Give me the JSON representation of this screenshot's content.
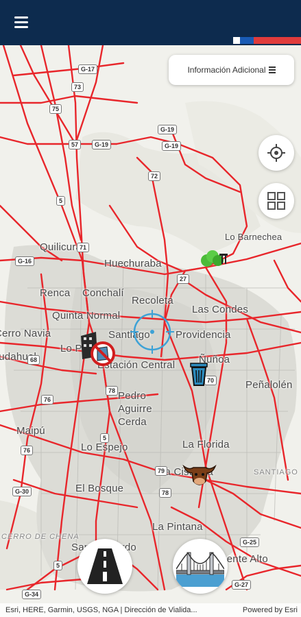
{
  "header": {
    "menu_icon": "hamburger-menu-icon",
    "background": "#0d2b4e",
    "flag_colors": [
      "#ffffff",
      "#1a5bb5",
      "#e03b3b"
    ]
  },
  "controls": {
    "info_button_label": "Información Adicional",
    "info_button_icon": "list-icon",
    "locate_icon": "crosshair-icon",
    "layers_icon": "grid-icon",
    "road_button_icon": "road-icon",
    "bridge_button_icon": "bridge-icon"
  },
  "map": {
    "road_color": "#e8262b",
    "places": [
      "Quilicura",
      "Huechuraba",
      "Renca",
      "Conchalí",
      "Recoleta",
      "Quinta Normal",
      "Lo Barnechea",
      "Las Condes",
      "Cerro Navia",
      "Lo Prado",
      "Santiago",
      "Providencia",
      "Pudahuel",
      "Estación Central",
      "Ñuñoa",
      "Peñalolén",
      "Pedro Aguirre Cerda",
      "Maipú",
      "Lo Espejo",
      "La Florida",
      "La Cisterna",
      "El Bosque",
      "La Pintana",
      "San Bernardo",
      "Puente Alto",
      "SANTIAGO",
      "CERRO DE CHENA"
    ],
    "route_shields": [
      "G-17",
      "73",
      "75",
      "57",
      "G-19",
      "G-19",
      "G-19",
      "5",
      "72",
      "71",
      "G-16",
      "27",
      "70",
      "68",
      "78",
      "76",
      "5",
      "76",
      "G-30",
      "78",
      "79",
      "G-25",
      "5",
      "G-34",
      "G-27"
    ],
    "markers": [
      "park-tree-icon",
      "building-blocked-icon",
      "trash-bin-icon",
      "cattle-icon",
      "map-location-target"
    ]
  },
  "attribution": {
    "left": "Esri, HERE, Garmin, USGS, NGA | Dirección de Vialida...",
    "right": "Powered by Esri"
  }
}
